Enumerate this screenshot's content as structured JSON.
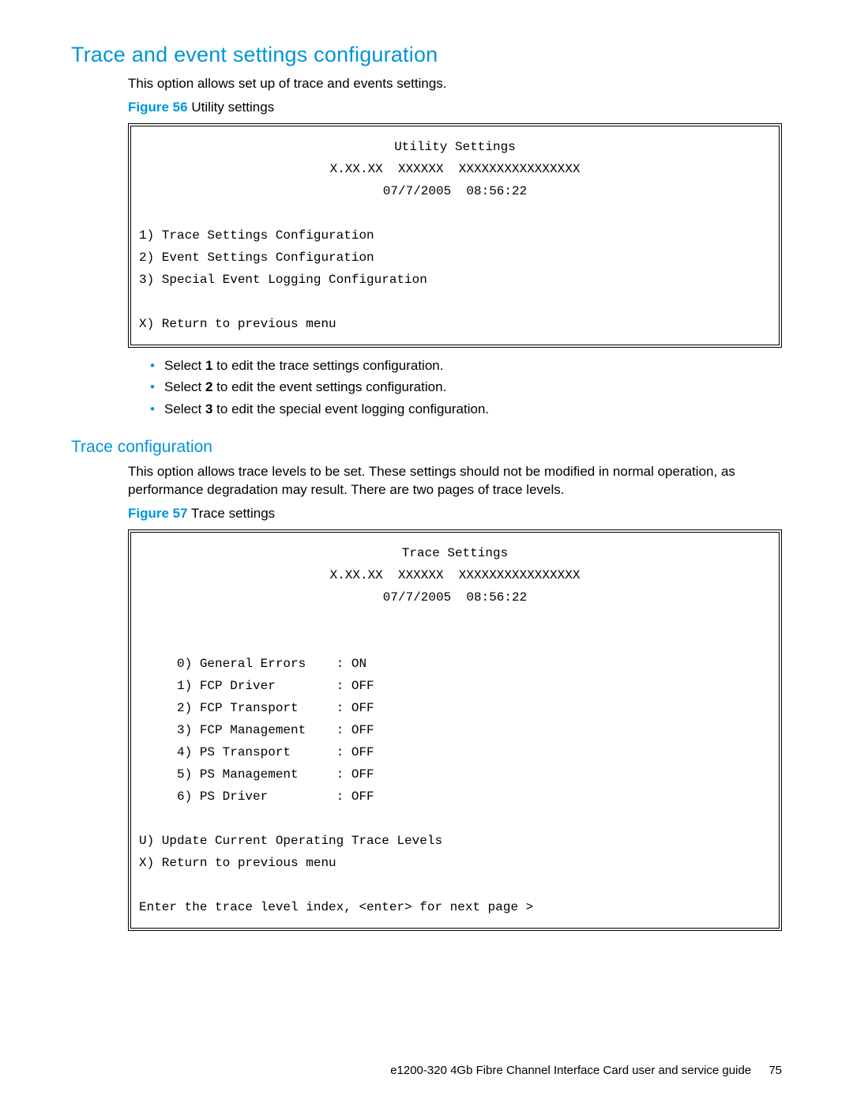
{
  "heading1": "Trace and event settings configuration",
  "intro1": "This option allows set up of trace and events settings.",
  "figure56": {
    "label_prefix": "Figure 56",
    "label_text": "Utility settings"
  },
  "terminal1": {
    "title": "Utility Settings",
    "version_line": "X.XX.XX  XXXXXX  XXXXXXXXXXXXXXXX",
    "date_line": "07/7/2005  08:56:22",
    "options": [
      "1) Trace Settings Configuration",
      "2) Event Settings Configuration",
      "3) Special Event Logging Configuration"
    ],
    "return_line": "X) Return to previous menu"
  },
  "bullets1": {
    "b1_pre": "Select ",
    "b1_bold": "1",
    "b1_post": " to edit the trace settings configuration.",
    "b2_pre": "Select ",
    "b2_bold": "2",
    "b2_post": " to edit the event settings configuration.",
    "b3_pre": "Select ",
    "b3_bold": "3",
    "b3_post": " to edit the special event logging configuration."
  },
  "heading2": "Trace configuration",
  "intro2": "This option allows trace levels to be set. These settings should not be modified in normal operation, as performance degradation may result. There are two pages of trace levels.",
  "figure57": {
    "label_prefix": "Figure 57",
    "label_text": "Trace settings"
  },
  "terminal2": {
    "title": "Trace Settings",
    "version_line": "X.XX.XX  XXXXXX  XXXXXXXXXXXXXXXX",
    "date_line": "07/7/2005  08:56:22",
    "items": [
      "     0) General Errors    : ON",
      "     1) FCP Driver        : OFF",
      "     2) FCP Transport     : OFF",
      "     3) FCP Management    : OFF",
      "     4) PS Transport      : OFF",
      "     5) PS Management     : OFF",
      "     6) PS Driver         : OFF"
    ],
    "update_line": "U) Update Current Operating Trace Levels",
    "return_line": "X) Return to previous menu",
    "prompt_line": "Enter the trace level index, <enter> for next page >"
  },
  "footer": {
    "doc_title": "e1200-320 4Gb Fibre Channel Interface Card user and service guide",
    "page_number": "75"
  }
}
